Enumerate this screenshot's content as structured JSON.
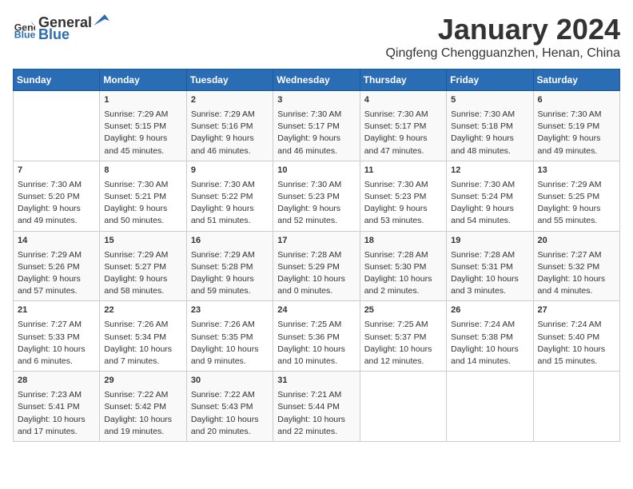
{
  "logo": {
    "general": "General",
    "blue": "Blue"
  },
  "title": "January 2024",
  "subtitle": "Qingfeng Chengguanzhen, Henan, China",
  "days_of_week": [
    "Sunday",
    "Monday",
    "Tuesday",
    "Wednesday",
    "Thursday",
    "Friday",
    "Saturday"
  ],
  "weeks": [
    [
      {
        "day": "",
        "info": ""
      },
      {
        "day": "1",
        "info": "Sunrise: 7:29 AM\nSunset: 5:15 PM\nDaylight: 9 hours\nand 45 minutes."
      },
      {
        "day": "2",
        "info": "Sunrise: 7:29 AM\nSunset: 5:16 PM\nDaylight: 9 hours\nand 46 minutes."
      },
      {
        "day": "3",
        "info": "Sunrise: 7:30 AM\nSunset: 5:17 PM\nDaylight: 9 hours\nand 46 minutes."
      },
      {
        "day": "4",
        "info": "Sunrise: 7:30 AM\nSunset: 5:17 PM\nDaylight: 9 hours\nand 47 minutes."
      },
      {
        "day": "5",
        "info": "Sunrise: 7:30 AM\nSunset: 5:18 PM\nDaylight: 9 hours\nand 48 minutes."
      },
      {
        "day": "6",
        "info": "Sunrise: 7:30 AM\nSunset: 5:19 PM\nDaylight: 9 hours\nand 49 minutes."
      }
    ],
    [
      {
        "day": "7",
        "info": "Sunrise: 7:30 AM\nSunset: 5:20 PM\nDaylight: 9 hours\nand 49 minutes."
      },
      {
        "day": "8",
        "info": "Sunrise: 7:30 AM\nSunset: 5:21 PM\nDaylight: 9 hours\nand 50 minutes."
      },
      {
        "day": "9",
        "info": "Sunrise: 7:30 AM\nSunset: 5:22 PM\nDaylight: 9 hours\nand 51 minutes."
      },
      {
        "day": "10",
        "info": "Sunrise: 7:30 AM\nSunset: 5:23 PM\nDaylight: 9 hours\nand 52 minutes."
      },
      {
        "day": "11",
        "info": "Sunrise: 7:30 AM\nSunset: 5:23 PM\nDaylight: 9 hours\nand 53 minutes."
      },
      {
        "day": "12",
        "info": "Sunrise: 7:30 AM\nSunset: 5:24 PM\nDaylight: 9 hours\nand 54 minutes."
      },
      {
        "day": "13",
        "info": "Sunrise: 7:29 AM\nSunset: 5:25 PM\nDaylight: 9 hours\nand 55 minutes."
      }
    ],
    [
      {
        "day": "14",
        "info": "Sunrise: 7:29 AM\nSunset: 5:26 PM\nDaylight: 9 hours\nand 57 minutes."
      },
      {
        "day": "15",
        "info": "Sunrise: 7:29 AM\nSunset: 5:27 PM\nDaylight: 9 hours\nand 58 minutes."
      },
      {
        "day": "16",
        "info": "Sunrise: 7:29 AM\nSunset: 5:28 PM\nDaylight: 9 hours\nand 59 minutes."
      },
      {
        "day": "17",
        "info": "Sunrise: 7:28 AM\nSunset: 5:29 PM\nDaylight: 10 hours\nand 0 minutes."
      },
      {
        "day": "18",
        "info": "Sunrise: 7:28 AM\nSunset: 5:30 PM\nDaylight: 10 hours\nand 2 minutes."
      },
      {
        "day": "19",
        "info": "Sunrise: 7:28 AM\nSunset: 5:31 PM\nDaylight: 10 hours\nand 3 minutes."
      },
      {
        "day": "20",
        "info": "Sunrise: 7:27 AM\nSunset: 5:32 PM\nDaylight: 10 hours\nand 4 minutes."
      }
    ],
    [
      {
        "day": "21",
        "info": "Sunrise: 7:27 AM\nSunset: 5:33 PM\nDaylight: 10 hours\nand 6 minutes."
      },
      {
        "day": "22",
        "info": "Sunrise: 7:26 AM\nSunset: 5:34 PM\nDaylight: 10 hours\nand 7 minutes."
      },
      {
        "day": "23",
        "info": "Sunrise: 7:26 AM\nSunset: 5:35 PM\nDaylight: 10 hours\nand 9 minutes."
      },
      {
        "day": "24",
        "info": "Sunrise: 7:25 AM\nSunset: 5:36 PM\nDaylight: 10 hours\nand 10 minutes."
      },
      {
        "day": "25",
        "info": "Sunrise: 7:25 AM\nSunset: 5:37 PM\nDaylight: 10 hours\nand 12 minutes."
      },
      {
        "day": "26",
        "info": "Sunrise: 7:24 AM\nSunset: 5:38 PM\nDaylight: 10 hours\nand 14 minutes."
      },
      {
        "day": "27",
        "info": "Sunrise: 7:24 AM\nSunset: 5:40 PM\nDaylight: 10 hours\nand 15 minutes."
      }
    ],
    [
      {
        "day": "28",
        "info": "Sunrise: 7:23 AM\nSunset: 5:41 PM\nDaylight: 10 hours\nand 17 minutes."
      },
      {
        "day": "29",
        "info": "Sunrise: 7:22 AM\nSunset: 5:42 PM\nDaylight: 10 hours\nand 19 minutes."
      },
      {
        "day": "30",
        "info": "Sunrise: 7:22 AM\nSunset: 5:43 PM\nDaylight: 10 hours\nand 20 minutes."
      },
      {
        "day": "31",
        "info": "Sunrise: 7:21 AM\nSunset: 5:44 PM\nDaylight: 10 hours\nand 22 minutes."
      },
      {
        "day": "",
        "info": ""
      },
      {
        "day": "",
        "info": ""
      },
      {
        "day": "",
        "info": ""
      }
    ]
  ]
}
